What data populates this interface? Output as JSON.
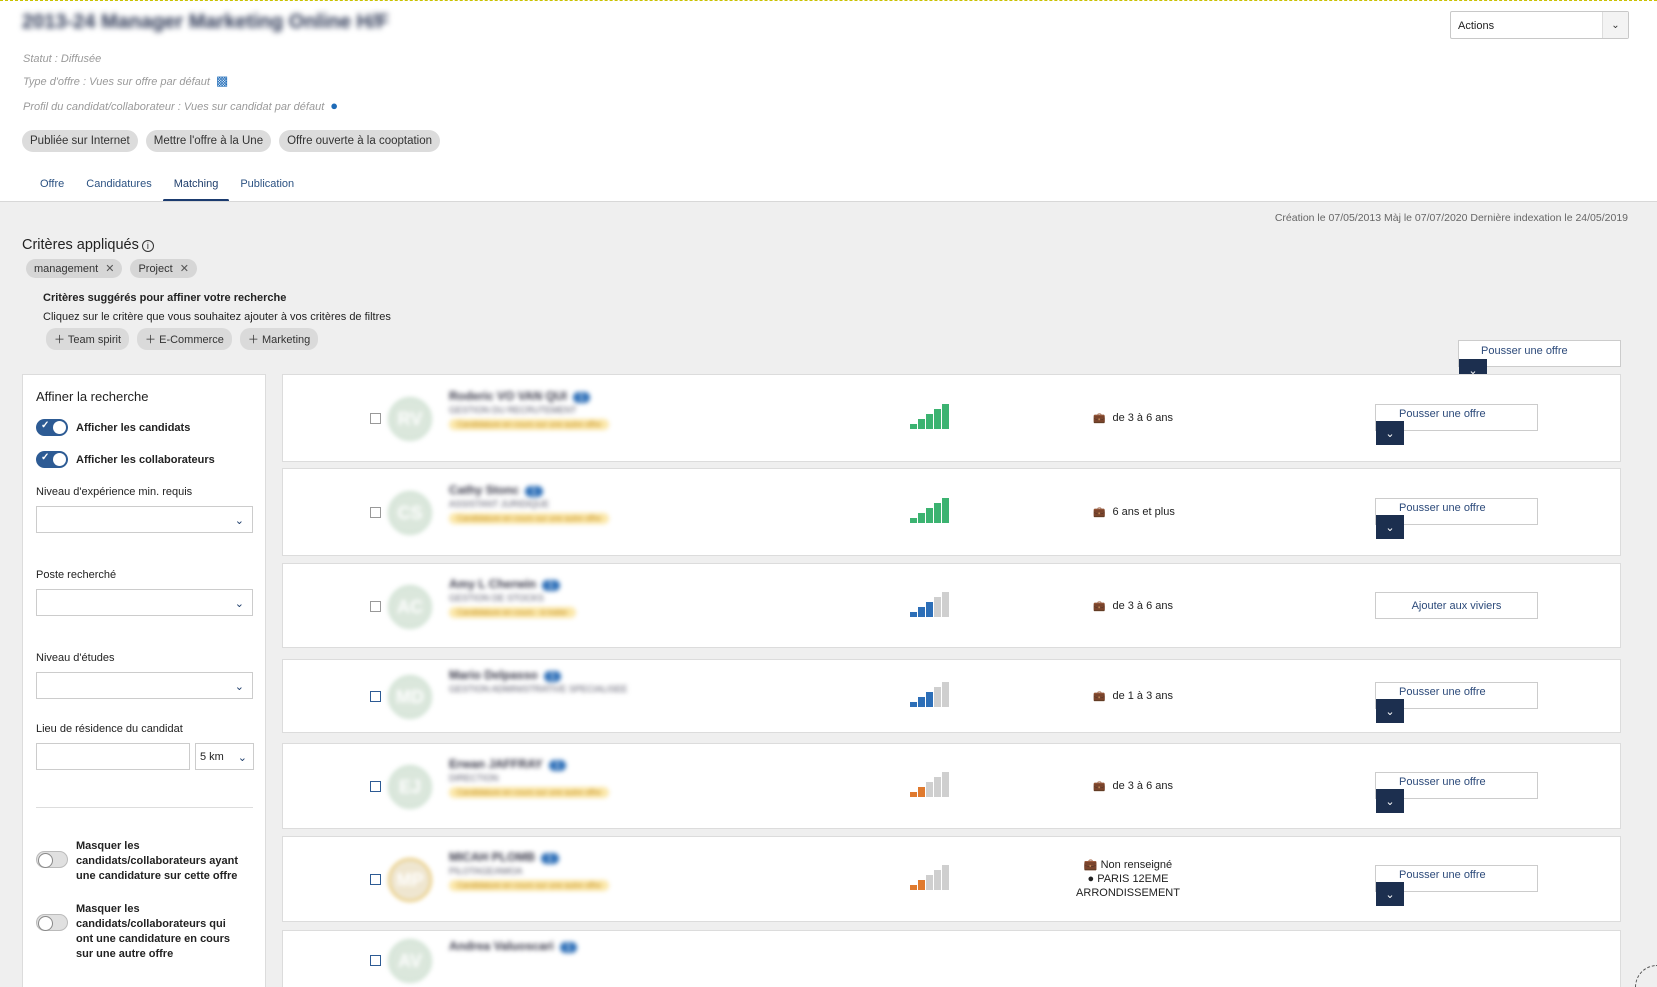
{
  "header": {
    "job_title": "2013-24 Manager Marketing Online H/F",
    "status": "Statut : Diffusée",
    "offer_type": "Type d'offre : Vues sur offre par défaut",
    "profile": "Profil du candidat/collaborateur : Vues sur candidat par défaut",
    "chips": [
      "Publiée sur Internet",
      "Mettre l'offre à la Une",
      "Offre ouverte à la cooptation"
    ],
    "actions_label": "Actions"
  },
  "tabs": [
    "Offre",
    "Candidatures",
    "Matching",
    "Publication"
  ],
  "active_tab": "Matching",
  "dates": "Création le 07/05/2013 Màj le 07/07/2020 Dernière indexation le 24/05/2019",
  "criteria": {
    "title": "Critères appliqués",
    "applied": [
      "management",
      "Project"
    ],
    "suggested_title": "Critères suggérés pour affiner votre recherche",
    "suggested_sub": "Cliquez sur le critère que vous souhaitez ajouter à vos critères de filtres",
    "suggested": [
      "Team spirit",
      "E-Commerce",
      "Marketing"
    ]
  },
  "push_label": "Pousser une offre",
  "vivier_label": "Ajouter aux viviers",
  "filters": {
    "title": "Affiner la recherche",
    "show_candidates": "Afficher les candidats",
    "show_collaborators": "Afficher les collaborateurs",
    "experience_label": "Niveau d'expérience min. requis",
    "position_label": "Poste recherché",
    "education_label": "Niveau d'études",
    "location_label": "Lieu de résidence du candidat",
    "distance_value": "5 km",
    "mask1": "Masquer les candidats/collaborateurs ayant une candidature sur cette offre",
    "mask2": "Masquer les candidats/collaborateurs qui ont une candidature en cours sur une autre offre"
  },
  "candidates": [
    {
      "initials": "RV",
      "name": "Roderic VO VAN QUI",
      "count": "1",
      "job": "GESTION DU RECRUTEMENT",
      "tag": "Candidature en cours sur une autre offre",
      "score": 5,
      "color": "#3cb371",
      "experience": "de 3 à 6 ans",
      "action": "push"
    },
    {
      "initials": "CS",
      "name": "Cathy Stonc",
      "count": "1",
      "job": "ASSISTANT JURIDIQUE",
      "tag": "Candidature en cours sur une autre offre",
      "score": 5,
      "color": "#3cb371",
      "experience": "6 ans et plus",
      "action": "push"
    },
    {
      "initials": "AC",
      "name": "Amy L Cherwin",
      "count": "1",
      "job": "GESTION DE STOCKS",
      "tag": "Candidature en cours - à traiter",
      "score": 3,
      "color": "#2d6fb8",
      "experience": "de 3 à 6 ans",
      "action": "vivier"
    },
    {
      "initials": "MD",
      "name": "Mario Delpasso",
      "count": "1",
      "job": "GESTION ADMINISTRATIVE SPECIALISEE",
      "tag": "",
      "score": 3,
      "color": "#2d6fb8",
      "experience": "de 1 à 3 ans",
      "action": "push"
    },
    {
      "initials": "EJ",
      "name": "Erwan JAFFRAY",
      "count": "1",
      "job": "DIRECTION",
      "tag": "Candidature en cours sur une autre offre",
      "score": 2,
      "color": "#e07a2e",
      "experience": "de 3 à 6 ans",
      "action": "push"
    },
    {
      "initials": "MP",
      "name": "MICAH PLOMB",
      "count": "1",
      "job": "PILOTAGE/AMOA",
      "tag": "Candidature en cours sur une autre offre",
      "score": 2,
      "color": "#e07a2e",
      "experience": "Non renseigné",
      "location": "PARIS 12EME ARRONDISSEMENT",
      "action": "push"
    },
    {
      "initials": "AV",
      "name": "Andrea Valuoscari",
      "count": "1",
      "job": "",
      "tag": "",
      "score": 0,
      "color": "#cccccc",
      "experience": "",
      "action": "none"
    }
  ]
}
